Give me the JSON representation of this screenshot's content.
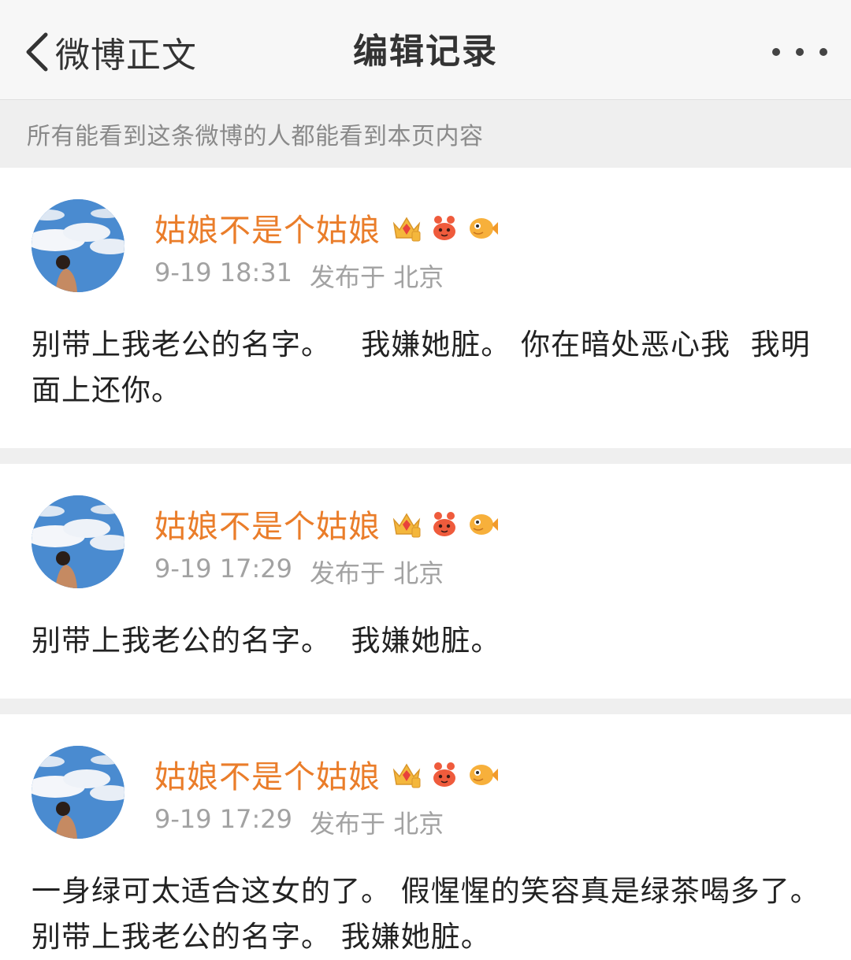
{
  "nav": {
    "back_label": "微博正文",
    "title": "编辑记录"
  },
  "notice": "所有能看到这条微博的人都能看到本页内容",
  "records": [
    {
      "username": "姑娘不是个姑娘",
      "time": "9-19 18:31",
      "source": "发布于 北京",
      "text": "别带上我老公的名字。   我嫌她脏。 你在暗处恶心我  我明面上还你。"
    },
    {
      "username": "姑娘不是个姑娘",
      "time": "9-19 17:29",
      "source": "发布于 北京",
      "text": "别带上我老公的名字。  我嫌她脏。"
    },
    {
      "username": "姑娘不是个姑娘",
      "time": "9-19 17:29",
      "source": "发布于 北京",
      "text": "一身绿可太适合这女的了。 假惺惺的笑容真是绿茶喝多了。 别带上我老公的名字。 我嫌她脏。"
    }
  ],
  "colors": {
    "username": "#ea7d2a",
    "meta": "#a2a2a2",
    "notice": "#8a8a8a",
    "background": "#efefef"
  },
  "icons": {
    "back": "chevron-left-icon",
    "more": "more-dots-icon",
    "badges": [
      "crown-vip-badge-icon",
      "crab-badge-icon",
      "fish-badge-icon"
    ]
  }
}
